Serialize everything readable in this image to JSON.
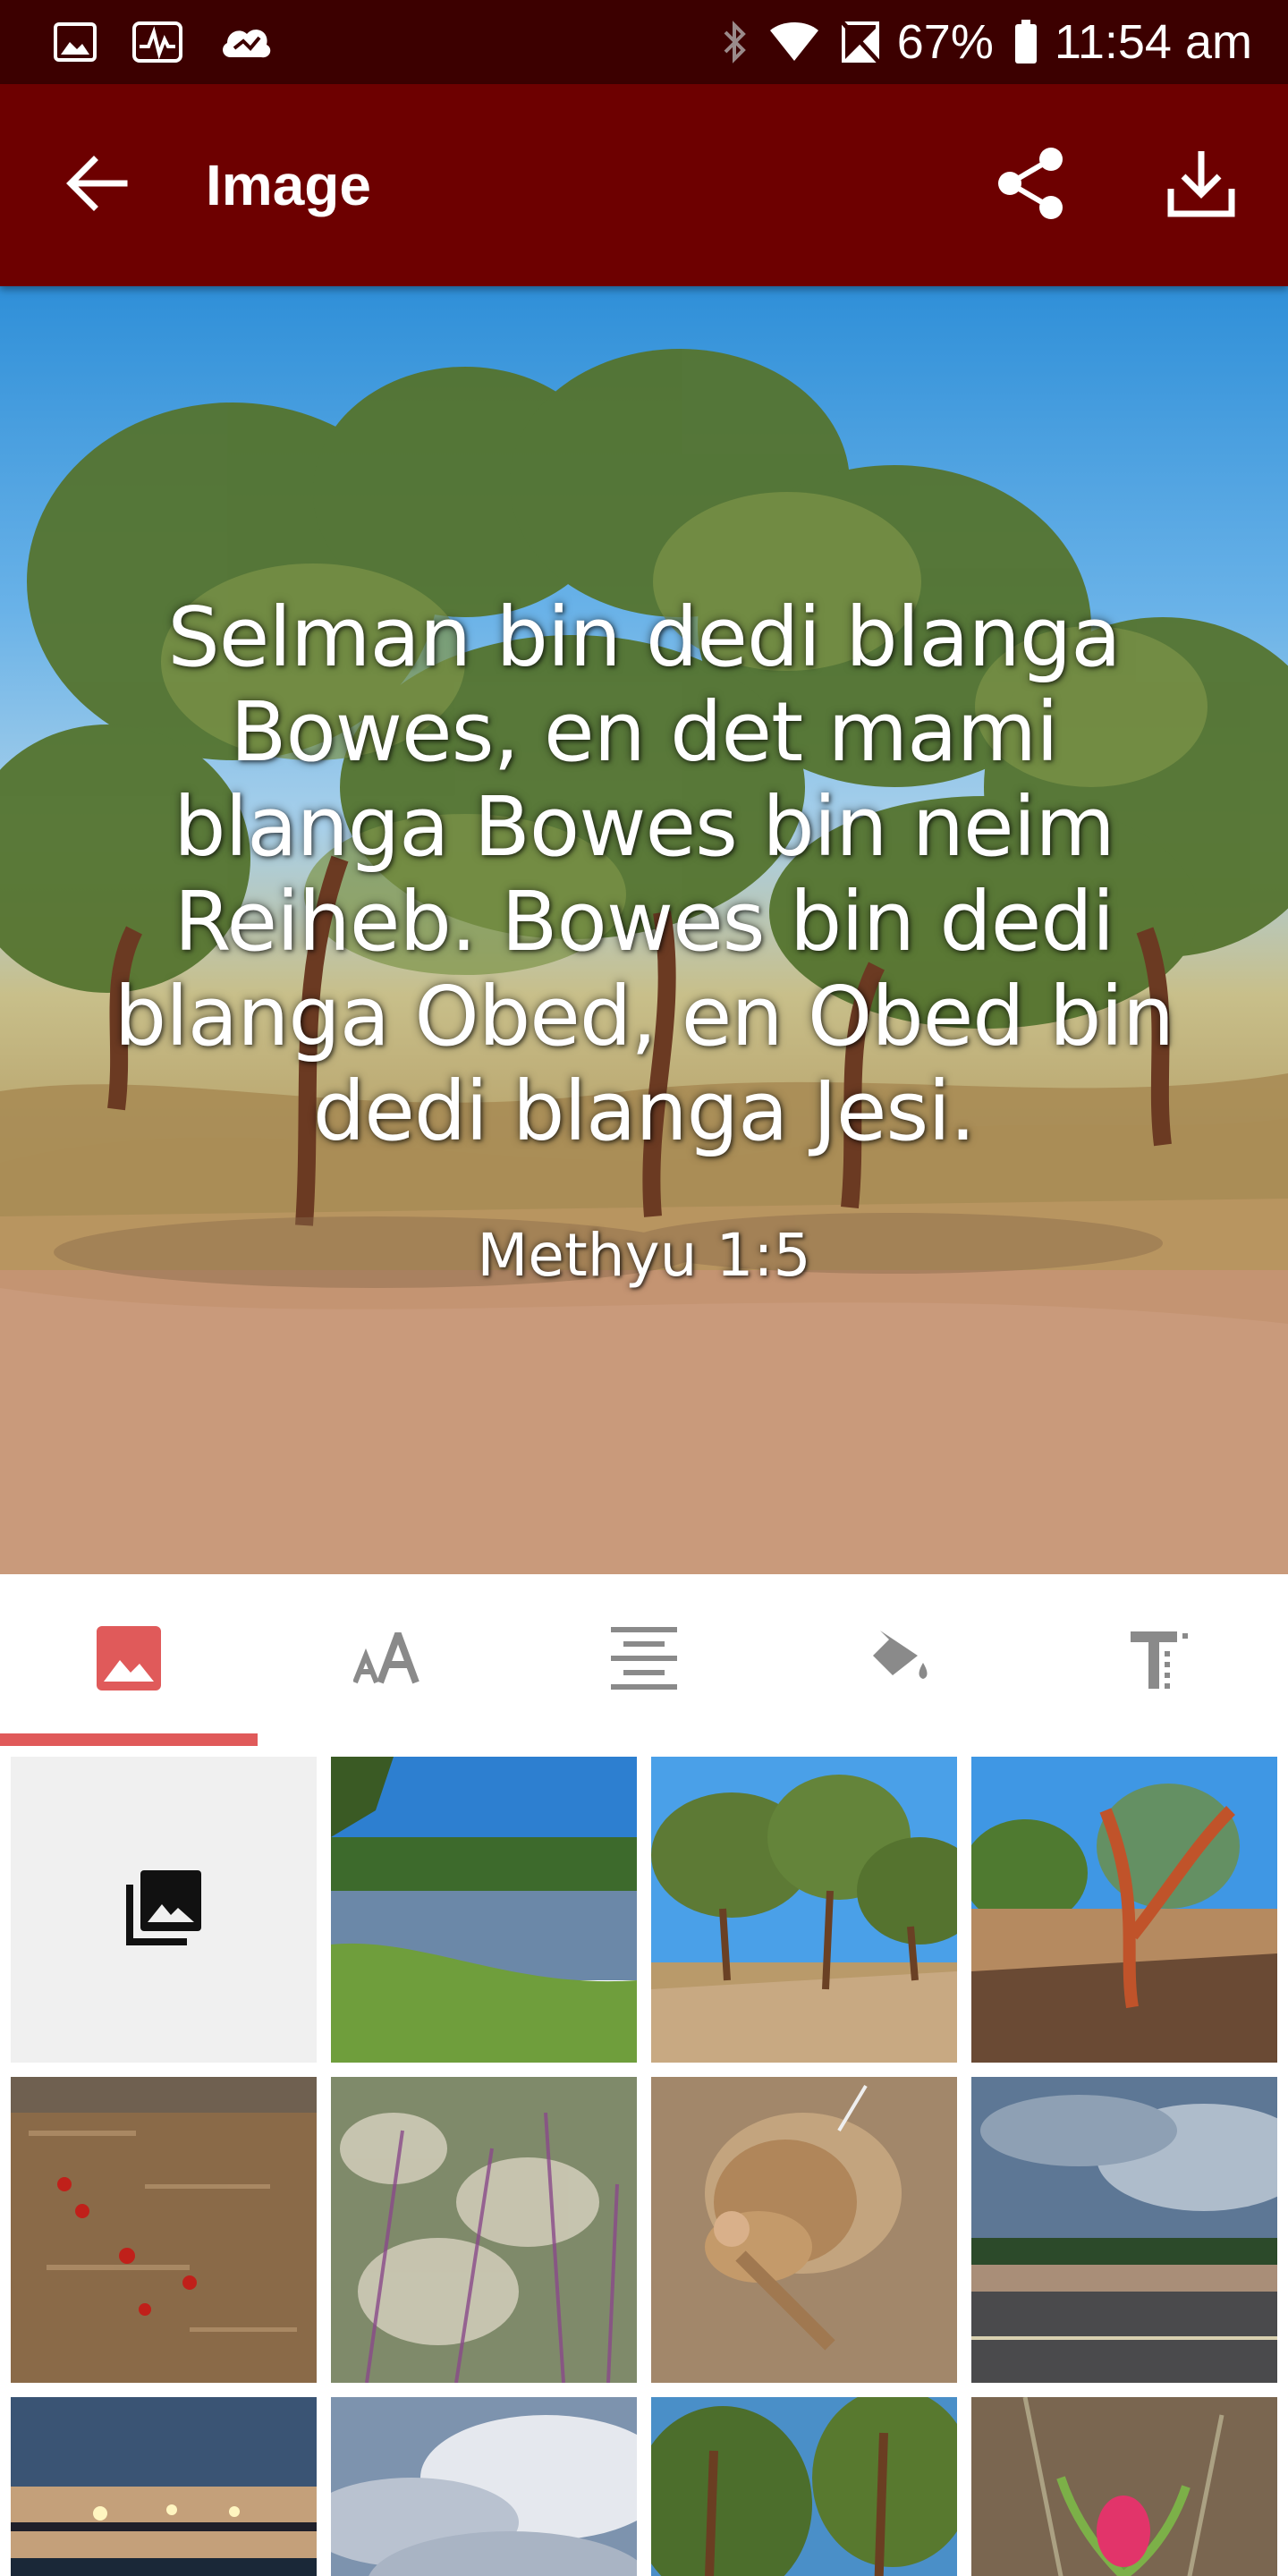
{
  "status_bar": {
    "battery": "67%",
    "time": "11:54 am",
    "left_icons": [
      "image-notification-icon",
      "activity-notification-icon",
      "cloud-sync-icon"
    ],
    "right_icons": [
      "bluetooth-icon",
      "wifi-icon",
      "no-sim-icon",
      "battery-icon"
    ]
  },
  "app_bar": {
    "title": "Image",
    "back_icon": "arrow-left-icon",
    "share_icon": "share-icon",
    "download_icon": "download-icon",
    "color": "#6d0000"
  },
  "preview": {
    "verse_text": "Selman bin dedi blanga Bowes, en det mami blanga Bowes bin neim Reiheb. Bowes bin dedi blanga Obed, en Obed bin dedi blanga Jesi.",
    "verse_lines": [
      "Selman bin dedi blanga",
      "Bowes, en det mami",
      "blanga Bowes bin neim",
      "Reiheb. Bowes bin dedi",
      "blanga Obed, en Obed bin",
      "dedi blanga Jesi."
    ],
    "reference": "Methyu 1:5"
  },
  "tabs": [
    {
      "name": "background-image",
      "icon": "image-icon",
      "selected": true
    },
    {
      "name": "font-size",
      "icon": "text-size-icon",
      "selected": false
    },
    {
      "name": "alignment",
      "icon": "align-center-icon",
      "selected": false
    },
    {
      "name": "color",
      "icon": "paint-bucket-icon",
      "selected": false
    },
    {
      "name": "font",
      "icon": "text-format-icon",
      "selected": false
    }
  ],
  "accent_color": "#e05a5a",
  "grid": {
    "gallery_icon": "photo-library-icon",
    "thumbnails": [
      {
        "name": "thumb-lake"
      },
      {
        "name": "thumb-trees-path"
      },
      {
        "name": "thumb-tree-red-trunk"
      },
      {
        "name": "thumb-dry-ground-flowers"
      },
      {
        "name": "thumb-purple-grass"
      },
      {
        "name": "thumb-small-mammal"
      },
      {
        "name": "thumb-storm-clouds-road"
      },
      {
        "name": "thumb-jetty-sunset"
      },
      {
        "name": "thumb-cloudy-sky"
      },
      {
        "name": "thumb-forest-trees"
      },
      {
        "name": "thumb-red-flower"
      }
    ]
  }
}
